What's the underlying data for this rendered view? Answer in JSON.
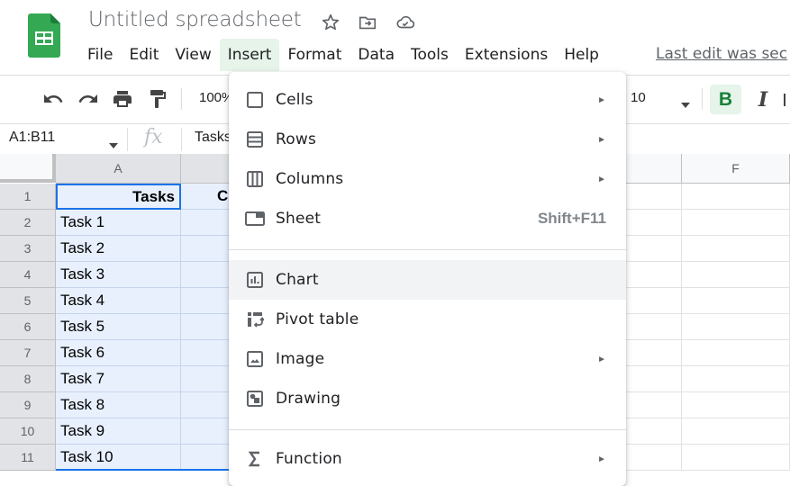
{
  "app": {
    "title": "Untitled spreadsheet",
    "last_edit": "Last edit was sec",
    "brand_color": "#34a853"
  },
  "menubar": [
    "File",
    "Edit",
    "View",
    "Insert",
    "Format",
    "Data",
    "Tools",
    "Extensions",
    "Help"
  ],
  "toolbar": {
    "zoom": "100%",
    "font_size": "10",
    "bold_label": "B",
    "italic_label": "I"
  },
  "formula_bar": {
    "name_box": "A1:B11",
    "fx_label": "fx",
    "formula": "Tasks"
  },
  "grid": {
    "columns": [
      "A",
      "",
      "F"
    ],
    "rows": [
      "1",
      "2",
      "3",
      "4",
      "5",
      "6",
      "7",
      "8",
      "9",
      "10",
      "11"
    ],
    "colA": [
      "Tasks",
      "Task 1",
      "Task 2",
      "Task 3",
      "Task 4",
      "Task 5",
      "Task 6",
      "Task 7",
      "Task 8",
      "Task 9",
      "Task 10"
    ],
    "colB_header_partial": "C"
  },
  "insert_menu": {
    "items": [
      {
        "label": "Cells",
        "icon": "cells-icon",
        "submenu": true
      },
      {
        "label": "Rows",
        "icon": "rows-icon",
        "submenu": true
      },
      {
        "label": "Columns",
        "icon": "columns-icon",
        "submenu": true
      },
      {
        "label": "Sheet",
        "icon": "sheet-icon",
        "shortcut": "Shift+F11"
      },
      {
        "label": "Chart",
        "icon": "chart-icon",
        "highlighted": true
      },
      {
        "label": "Pivot table",
        "icon": "pivot-table-icon"
      },
      {
        "label": "Image",
        "icon": "image-icon",
        "submenu": true
      },
      {
        "label": "Drawing",
        "icon": "drawing-icon"
      },
      {
        "label": "Function",
        "icon": "sigma-icon",
        "submenu": true
      }
    ],
    "arrow_glyph": "►"
  }
}
